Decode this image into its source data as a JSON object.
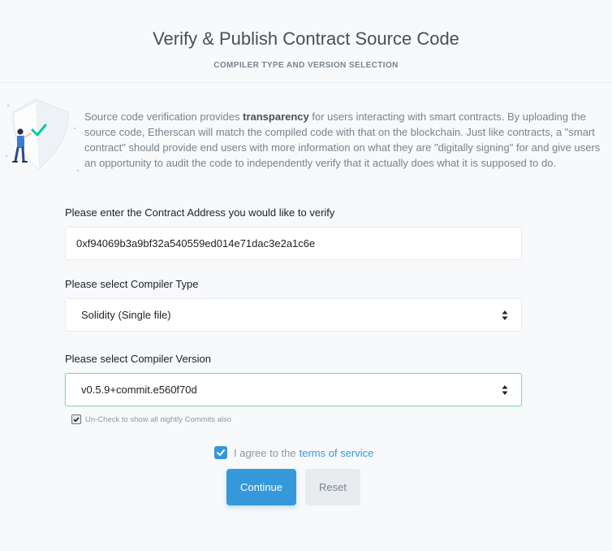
{
  "header": {
    "title": "Verify & Publish Contract Source Code",
    "subtitle": "COMPILER TYPE AND VERSION SELECTION"
  },
  "intro": {
    "text_before": "Source code verification provides ",
    "emphasis": "transparency",
    "text_after": " for users interacting with smart contracts. By uploading the source code, Etherscan will match the compiled code with that on the blockchain. Just like contracts, a \"smart contract\" should provide end users with more information on what they are \"digitally signing\" for and give users an opportunity to audit the code to independently verify that it actually does what it is supposed to do."
  },
  "form": {
    "address_label": "Please enter the Contract Address you would like to verify",
    "address_value": "0xf94069b3a9bf32a540559ed014e71dac3e2a1c6e",
    "compiler_type_label": "Please select Compiler Type",
    "compiler_type_value": "Solidity (Single file)",
    "compiler_version_label": "Please select Compiler Version",
    "compiler_version_value": "v0.5.9+commit.e560f70d",
    "nightly_label": "Un-Check to show all nightly Commits also",
    "nightly_checked": true,
    "agree_prefix": "I agree to the",
    "agree_link": "terms of service",
    "agree_checked": true
  },
  "buttons": {
    "continue": "Continue",
    "reset": "Reset"
  },
  "colors": {
    "accent": "#3498db",
    "focus_border": "#7fdbb6",
    "check_green": "#00c9a7"
  },
  "icons": [
    "illustration-shield-person",
    "select-arrows-icon",
    "checkmark-icon"
  ]
}
